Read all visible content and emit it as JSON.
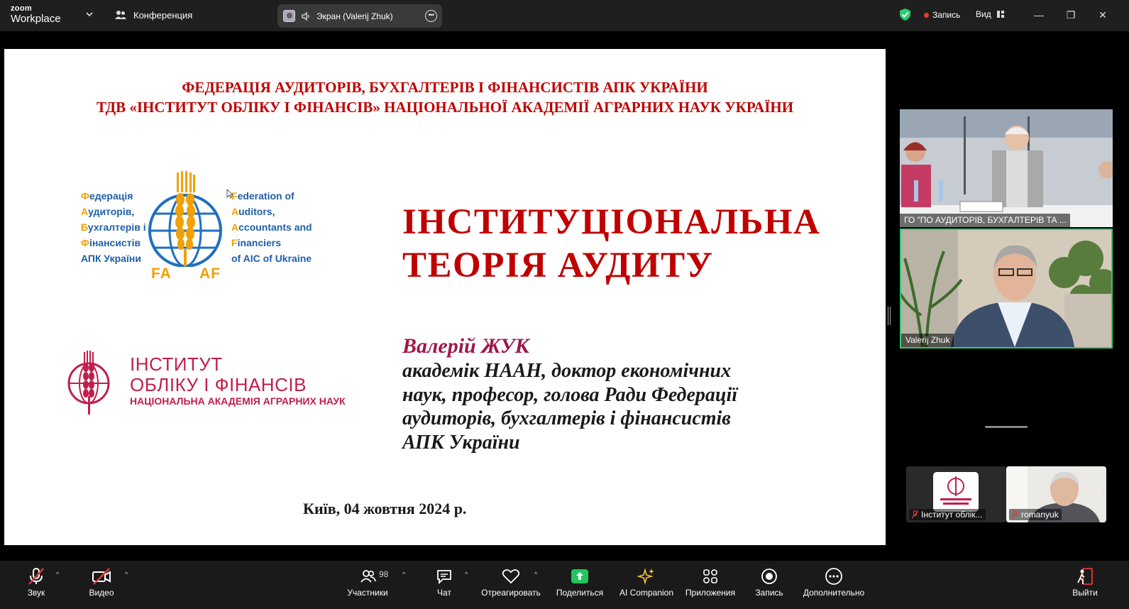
{
  "app": {
    "logo_top": "zoom",
    "logo_bottom": "Workplace",
    "meeting_label": "Конференция",
    "share_indicator": "Экран (Valerij Zhuk)",
    "record_label": "Запись",
    "view_label": "Вид",
    "minimize": "—",
    "restore": "❐",
    "close": "✕",
    "colors": {
      "green": "#2ecc71",
      "record_red": "#e53935",
      "share_green": "#22c55e"
    }
  },
  "slide": {
    "org_line_1": "ФЕДЕРАЦІЯ АУДИТОРІВ, БУХГАЛТЕРІВ І ФІНАНСИСТІВ АПК УКРАЇНИ",
    "org_line_2": "ТДВ «ІНСТИТУТ ОБЛІКУ І ФІНАНСІВ» НАЦІОНАЛЬНОЇ АКАДЕМІЇ АГРАРНИХ НАУК УКРАЇНИ",
    "faaf_left": [
      {
        "first": "Ф",
        "rest": "едерація"
      },
      {
        "first": "А",
        "rest": "удиторів,"
      },
      {
        "first": "Б",
        "rest": "ухгалтерів і"
      },
      {
        "first": "Ф",
        "rest": "інансистів"
      },
      {
        "first": "",
        "rest": "АПК України"
      }
    ],
    "faaf_right": [
      {
        "first": "F",
        "rest": "ederation of"
      },
      {
        "first": "A",
        "rest": "uditors,"
      },
      {
        "first": "A",
        "rest": "ccountants and"
      },
      {
        "first": "F",
        "rest": "inanciers"
      },
      {
        "first": "",
        "rest": "of AIC of Ukraine"
      }
    ],
    "faaf_fa": "FA",
    "faaf_af": "AF",
    "institute_name_1": "ІНСТИТУТ",
    "institute_name_2": "ОБЛІКУ І ФІНАНСІВ",
    "institute_name_3": "НАЦІОНАЛЬНА АКАДЕМІЯ АГРАРНИХ НАУК",
    "title_line_1": "ІНСТИТУЦІОНАЛЬНА",
    "title_line_2": "ТЕОРІЯ АУДИТУ",
    "author": "Валерій ЖУК",
    "author_desc_1": "академік НААН, доктор економічних",
    "author_desc_2": "наук, професор, голова Ради Федерації",
    "author_desc_3": "аудиторів, бухгалтерів і фінансистів",
    "author_desc_4": "АПК України",
    "place_date": "Київ, 04 жовтня 2024 р."
  },
  "participants": {
    "tile1_name": "ГО \"ПО АУДИТОРІВ, БУХГАЛТЕРІВ ТА ...",
    "tile2_name": "Valerij Zhuk",
    "thumb1_name": "Інститут облік...",
    "thumb2_name": "romanyuk"
  },
  "toolbar": {
    "audio": "Звук",
    "video": "Видео",
    "participants": "Участники",
    "participants_count": "98",
    "chat": "Чат",
    "react": "Отреагировать",
    "share": "Поделиться",
    "ai": "AI Companion",
    "apps": "Приложения",
    "record": "Запись",
    "more": "Дополнительно",
    "leave": "Выйти"
  }
}
